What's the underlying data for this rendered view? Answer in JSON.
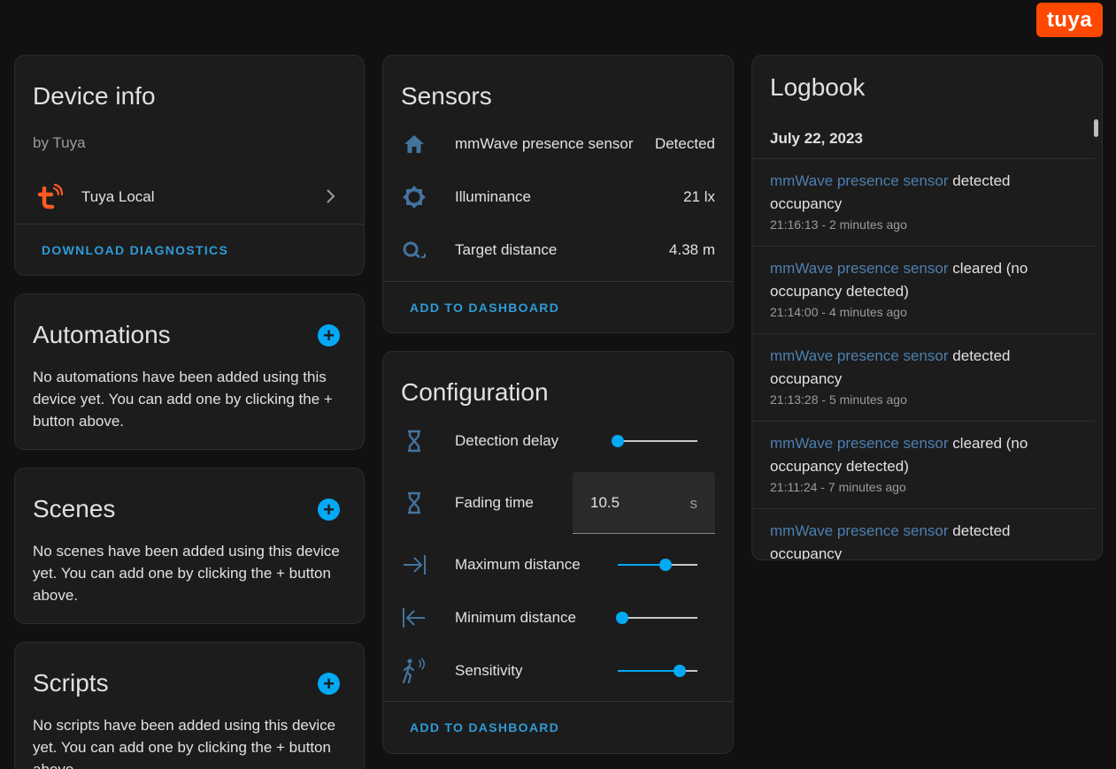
{
  "brand": {
    "logo_text": "tuya",
    "logo_color": "#ff4800"
  },
  "device_info": {
    "title": "Device info",
    "by": "by Tuya",
    "integration": "Tuya Local",
    "download": "DOWNLOAD DIAGNOSTICS"
  },
  "automations": {
    "title": "Automations",
    "text": "No automations have been added using this device yet. You can add one by clicking the + button above."
  },
  "scenes": {
    "title": "Scenes",
    "text": "No scenes have been added using this device yet. You can add one by clicking the + button above."
  },
  "scripts": {
    "title": "Scripts",
    "text": "No scripts have been added using this device yet. You can add one by clicking the + button above."
  },
  "sensors": {
    "title": "Sensors",
    "items": [
      {
        "label": "mmWave presence sensor",
        "value": "Detected",
        "icon": "home-icon"
      },
      {
        "label": "Illuminance",
        "value": "21 lx",
        "icon": "brightness-icon"
      },
      {
        "label": "Target distance",
        "value": "4.38 m",
        "icon": "magnify-distance-icon"
      }
    ],
    "add": "ADD TO DASHBOARD"
  },
  "configuration": {
    "title": "Configuration",
    "items": [
      {
        "label": "Detection delay",
        "type": "slider",
        "level": 0.0,
        "icon": "hourglass-icon"
      },
      {
        "label": "Fading time",
        "type": "number",
        "value": "10.5",
        "unit": "s",
        "icon": "hourglass-icon"
      },
      {
        "label": "Maximum distance",
        "type": "slider",
        "level": 0.6,
        "icon": "arrow-collapse-right-icon"
      },
      {
        "label": "Minimum distance",
        "type": "slider",
        "level": 0.05,
        "icon": "arrow-collapse-left-icon"
      },
      {
        "label": "Sensitivity",
        "type": "slider",
        "level": 0.78,
        "icon": "motion-sensor-icon"
      }
    ],
    "add": "ADD TO DASHBOARD"
  },
  "logbook": {
    "title": "Logbook",
    "date": "July 22, 2023",
    "entries": [
      {
        "entity": "mmWave presence sensor",
        "msg": " detected occupancy",
        "time": "21:16:13 - 2 minutes ago"
      },
      {
        "entity": "mmWave presence sensor",
        "msg": " cleared (no occupancy detected)",
        "time": "21:14:00 - 4 minutes ago"
      },
      {
        "entity": "mmWave presence sensor",
        "msg": " detected occupancy",
        "time": "21:13:28 - 5 minutes ago"
      },
      {
        "entity": "mmWave presence sensor",
        "msg": " cleared (no occupancy detected)",
        "time": "21:11:24 - 7 minutes ago"
      },
      {
        "entity": "mmWave presence sensor",
        "msg": " detected occupancy",
        "time": ""
      }
    ]
  },
  "colors": {
    "accent": "#03a9f4",
    "link": "#2e9bd6",
    "icon": "#44739e",
    "card": "#1c1c1c",
    "background": "#111111"
  }
}
